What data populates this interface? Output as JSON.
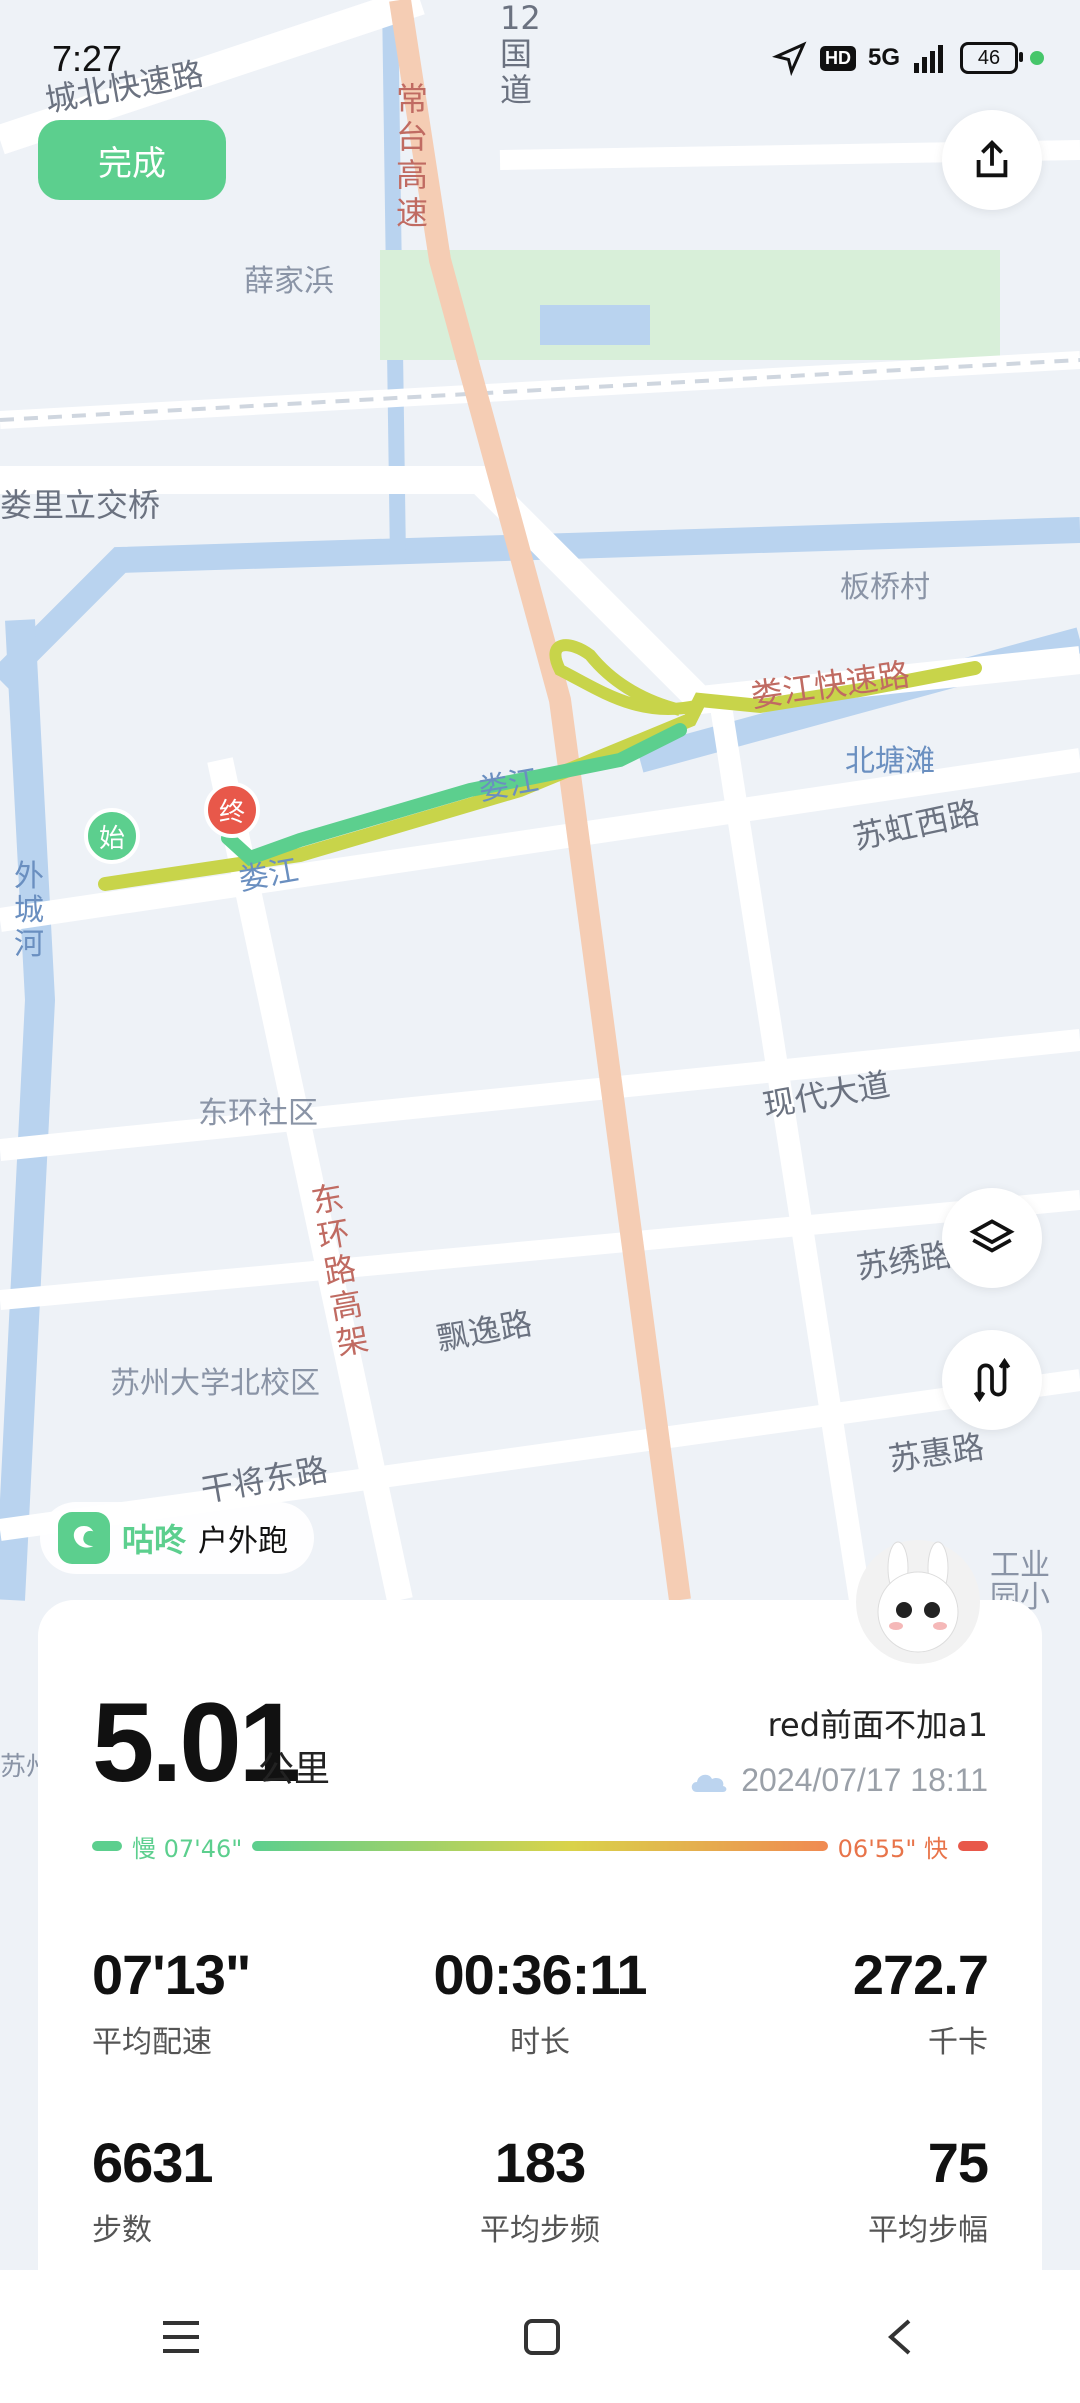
{
  "status_bar": {
    "time": "7:27",
    "signal": "5G",
    "battery": "46"
  },
  "header": {
    "done_label": "完成"
  },
  "map": {
    "labels": {
      "xuejiabang": "薛家浜",
      "road_g2": "12国道",
      "changtai": "常台高速",
      "chengbei": "城北快速路",
      "lili_bridge": "娄里立交桥",
      "banqiaocun": "板桥村",
      "lianjiang": "娄江快速路",
      "beitangtan": "北塘滩",
      "suhong": "苏虹西路",
      "waichenghe": "外城河",
      "dongshe": "东环社区",
      "xiandai": "现代大道",
      "donghuan": "东环路高架",
      "piaoyi": "飘逸路",
      "suxiu": "苏绣路",
      "suzhou_univ": "苏州大学北校区",
      "ganjiang": "干将东路",
      "suhui": "苏惠路",
      "industrial": "工业园小学",
      "loujiang_small": "娄江",
      "loujiang_river": "娄江",
      "suzhou_left": "苏州"
    },
    "markers": {
      "start": "始",
      "end": "终"
    },
    "route_color_start": "#5ccf8e",
    "route_color_end": "#c8d44a"
  },
  "brand": {
    "name": "咕咚",
    "type": "户外跑"
  },
  "summary": {
    "distance": "5.01",
    "distance_unit": "公里",
    "username": "red前面不加a1",
    "datetime": "2024/07/17 18:11",
    "pace_slow": "慢 07'46\"",
    "pace_fast": "06'55\" 快"
  },
  "stats": [
    {
      "value": "07'13\"",
      "label": "平均配速"
    },
    {
      "value": "00:36:11",
      "label": "时长"
    },
    {
      "value": "272.7",
      "label": "千卡"
    },
    {
      "value": "6631",
      "label": "步数"
    },
    {
      "value": "183",
      "label": "平均步频"
    },
    {
      "value": "75",
      "label": "平均步幅"
    }
  ],
  "colors": {
    "accent": "#5ccf8e",
    "fast": "#e8584a"
  }
}
